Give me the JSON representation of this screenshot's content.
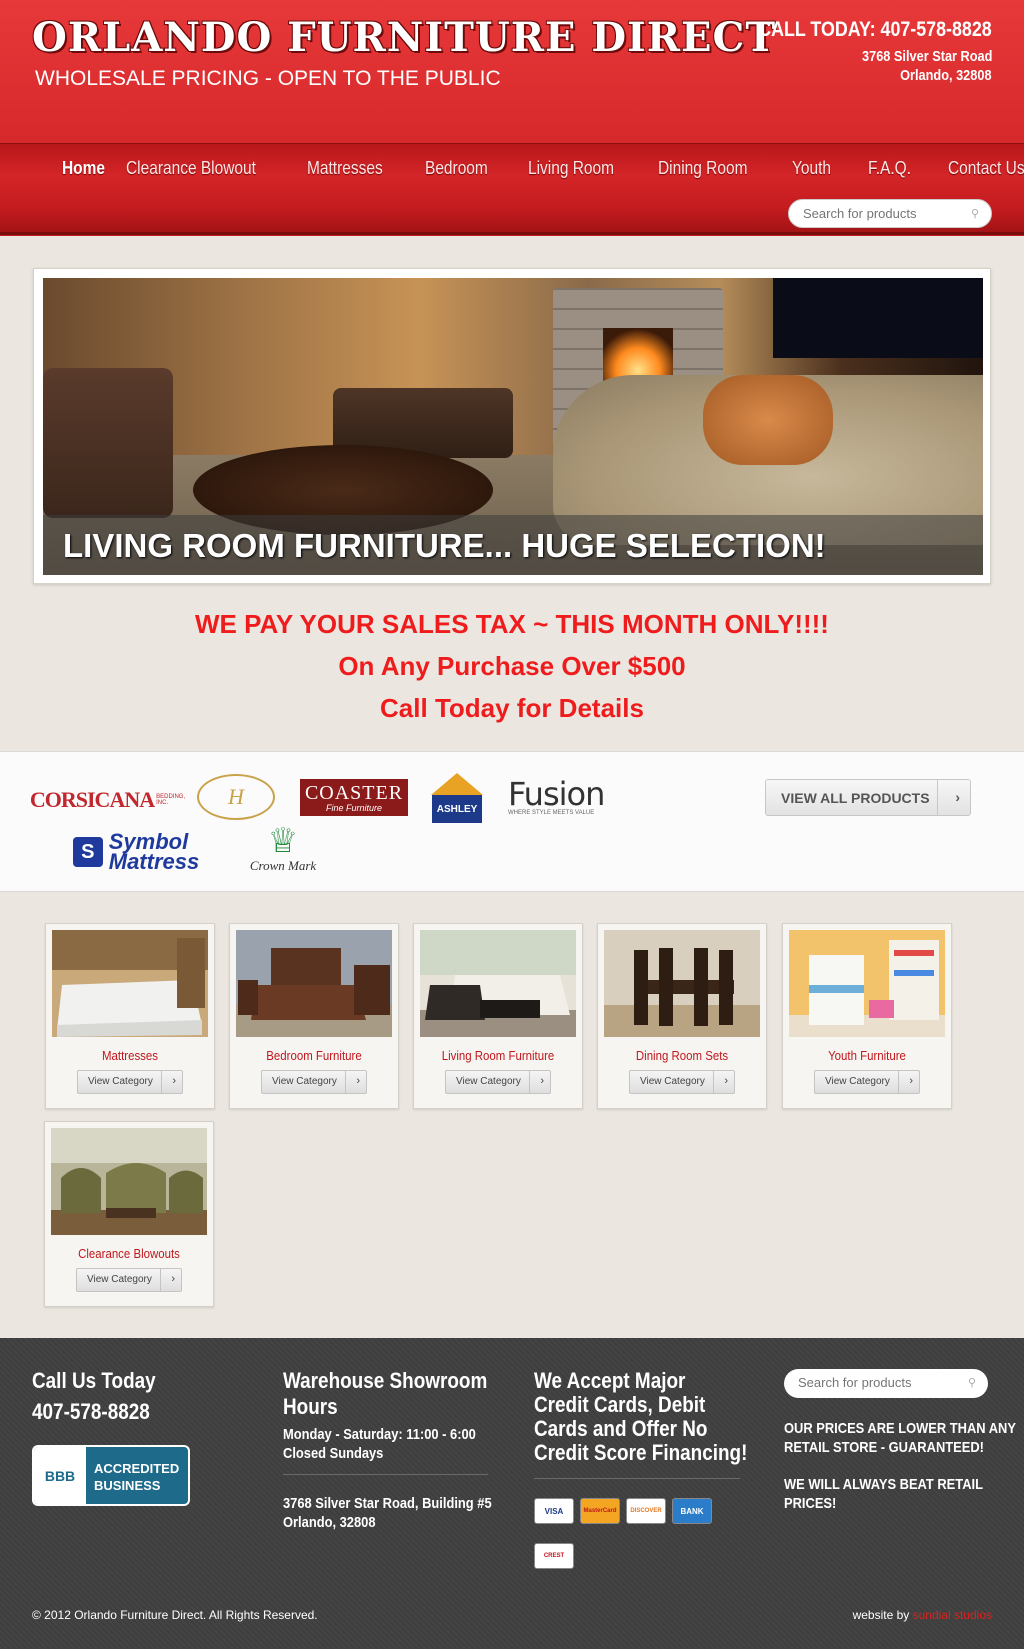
{
  "header": {
    "title": "ORLANDO FURNITURE DIRECT",
    "tagline": "WHOLESALE PRICING - OPEN TO THE PUBLIC",
    "call": "CALL TODAY: 407-578-8828",
    "address_line1": "3768 Silver Star Road",
    "address_line2": "Orlando, 32808"
  },
  "nav": {
    "items": [
      "Home",
      "Clearance Blowout",
      "Mattresses",
      "Bedroom",
      "Living Room",
      "Dining Room",
      "Youth",
      "F.A.Q.",
      "Contact Us"
    ],
    "active": "Home",
    "search_placeholder": "Search for products"
  },
  "hero": {
    "caption": "LIVING ROOM FURNITURE... HUGE SELECTION!"
  },
  "promo": {
    "line1": "WE PAY YOUR SALES TAX ~ THIS MONTH ONLY!!!!",
    "line2": "On Any Purchase Over $500",
    "line3": "Call Today for Details",
    "color": "#ee1c1c"
  },
  "brands": {
    "corsicana": "CORSICANA",
    "corsicana_sub": "BEDDING, INC.",
    "homerance": "H",
    "coaster": "COASTER",
    "coaster_sub": "Fine Furniture",
    "ashley": "ASHLEY",
    "fusion": "Fusion",
    "fusion_sub": "WHERE STYLE MEETS VALUE",
    "symbol_line1": "Symbol",
    "symbol_line2": "Mattress",
    "crown": "Crown Mark",
    "view_all": "VIEW ALL PRODUCTS"
  },
  "categories": [
    {
      "name": "Mattresses",
      "button": "View Category"
    },
    {
      "name": "Bedroom Furniture",
      "button": "View Category"
    },
    {
      "name": "Living Room Furniture",
      "button": "View Category"
    },
    {
      "name": "Dining Room Sets",
      "button": "View Category"
    },
    {
      "name": "Youth Furniture",
      "button": "View Category"
    },
    {
      "name": "Clearance Blowouts",
      "button": "View Category"
    }
  ],
  "footer": {
    "call_heading": "Call Us Today",
    "phone": "407-578-8828",
    "bbb_line1": "ACCREDITED",
    "bbb_line2": "BUSINESS",
    "bbb_mark": "BBB",
    "hours_heading_1": "Warehouse Showroom",
    "hours_heading_2": "Hours",
    "hours_1": "Monday - Saturday: 11:00 - 6:00",
    "hours_2": "Closed Sundays",
    "address_1": "3768 Silver Star Road, Building #5",
    "address_2": "Orlando, 32808",
    "credit_heading_1": "We Accept Major",
    "credit_heading_2": "Credit Cards, Debit",
    "credit_heading_3": "Cards and Offer No",
    "credit_heading_4": "Credit Score Financing!",
    "cards": [
      "VISA",
      "MasterCard",
      "DISCOVER",
      "BANK"
    ],
    "crest": "CREST",
    "search_placeholder": "Search for products",
    "guarantee_1": "OUR PRICES ARE LOWER THAN ANY",
    "guarantee_2": "RETAIL STORE - GUARANTEED!",
    "beat_1": "WE WILL ALWAYS BEAT RETAIL",
    "beat_2": "PRICES!",
    "copyright": "© 2012 Orlando Furniture Direct. All Rights Reserved.",
    "credit_prefix": "website by",
    "credit_link": "sundial studios"
  },
  "colors": {
    "brand_red": "#d82a2c",
    "accent_red": "#c0171c",
    "footer_bg": "#3e3e3e"
  }
}
